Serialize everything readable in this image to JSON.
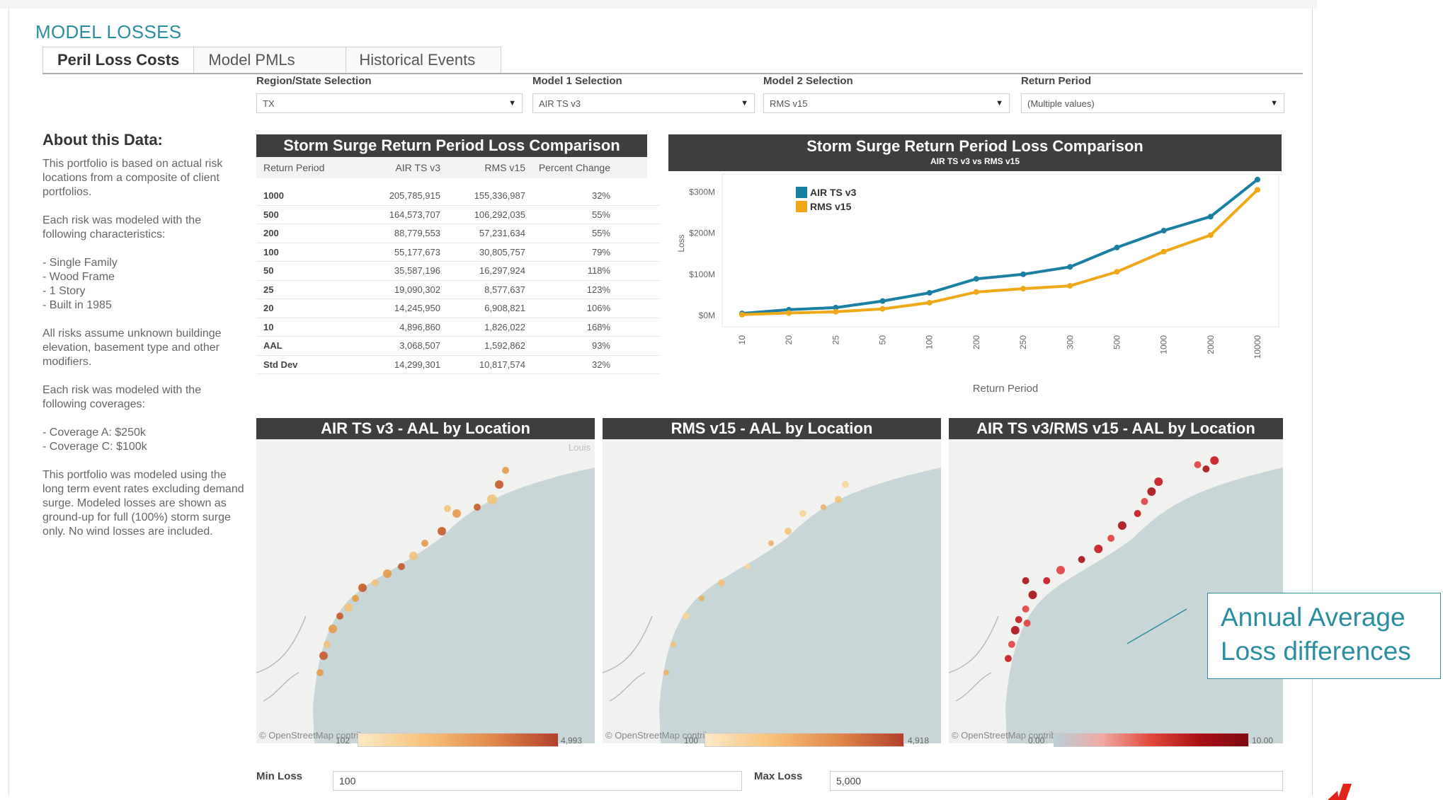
{
  "app": {
    "title": "MODEL LOSSES"
  },
  "tabs": [
    {
      "label": "Peril Loss Costs"
    },
    {
      "label": "Model PMLs"
    },
    {
      "label": "Historical Events"
    }
  ],
  "filters": [
    {
      "label": "Region/State Selection",
      "value": "TX"
    },
    {
      "label": "Model 1 Selection",
      "value": "AIR TS v3"
    },
    {
      "label": "Model 2 Selection",
      "value": "RMS v15"
    },
    {
      "label": "Return Period",
      "value": "(Multiple values)"
    }
  ],
  "about": {
    "title": "About this Data:",
    "paragraphs": [
      "This portfolio is based on actual risk locations from a composite of client portfolios.",
      "Each risk was modeled with the following characteristics:",
      "- Single Family\n- Wood Frame\n- 1 Story\n- Built in 1985",
      "All risks assume unknown buildinge elevation, basement type and other modifiers.",
      "Each risk was modeled with the following coverages:",
      "- Coverage A:  $250k\n- Coverage C:  $100k",
      "This portfolio was modeled using the long term event rates excluding demand surge. Modeled losses are shown as ground-up for full (100%) storm surge only. No wind losses are included."
    ]
  },
  "table": {
    "title": "Storm Surge Return Period Loss Comparison",
    "columns": [
      "Return Period",
      "AIR TS v3",
      "RMS v15",
      "Percent Change"
    ],
    "rows": [
      [
        "1000",
        "205,785,915",
        "155,336,987",
        "32%"
      ],
      [
        "500",
        "164,573,707",
        "106,292,035",
        "55%"
      ],
      [
        "200",
        "88,779,553",
        "57,231,634",
        "55%"
      ],
      [
        "100",
        "55,177,673",
        "30,805,757",
        "79%"
      ],
      [
        "50",
        "35,587,196",
        "16,297,924",
        "118%"
      ],
      [
        "25",
        "19,090,302",
        "8,577,637",
        "123%"
      ],
      [
        "20",
        "14,245,950",
        "6,908,821",
        "106%"
      ],
      [
        "10",
        "4,896,860",
        "1,826,022",
        "168%"
      ],
      [
        "AAL",
        "3,068,507",
        "1,592,862",
        "93%"
      ],
      [
        "Std Dev",
        "14,299,301",
        "10,817,574",
        "32%"
      ]
    ]
  },
  "chart_data": {
    "type": "line",
    "title": "Storm Surge Return Period Loss Comparison",
    "subtitle": "AIR TS v3 vs RMS v15",
    "xlabel": "Return Period",
    "ylabel": "Loss",
    "categories": [
      "10",
      "20",
      "25",
      "50",
      "100",
      "200",
      "250",
      "300",
      "500",
      "1000",
      "2000",
      "10000"
    ],
    "yticks": [
      "$0M",
      "$100M",
      "$200M",
      "$300M"
    ],
    "ylim": [
      0,
      340
    ],
    "series": [
      {
        "name": "AIR TS v3",
        "color": "#1b7fa3",
        "values": [
          5,
          14,
          19,
          35,
          55,
          89,
          100,
          118,
          165,
          206,
          240,
          330
        ]
      },
      {
        "name": "RMS v15",
        "color": "#f0a818",
        "values": [
          2,
          6,
          9,
          16,
          31,
          57,
          65,
          72,
          106,
          155,
          195,
          305
        ]
      }
    ],
    "legend": "top-left",
    "grid": false
  },
  "maps": [
    {
      "title": "AIR TS v3 - AAL by Location",
      "attribution": "© OpenStreetMap contributors",
      "legend_min": "102",
      "legend_max": "4,993",
      "place_label": "Louis"
    },
    {
      "title": "RMS v15 - AAL by Location",
      "attribution": "© OpenStreetMap contributors",
      "legend_min": "100",
      "legend_max": "4,918"
    },
    {
      "title": "AIR TS v3/RMS v15 - AAL by Location",
      "attribution": "© OpenStreetMap contributors",
      "legend_min": "0.00",
      "legend_max": "10.00"
    }
  ],
  "loss_filters": {
    "min_label": "Min Loss",
    "min_value": "100",
    "max_label": "Max Loss",
    "max_value": "5,000"
  },
  "callout": {
    "line1": "Annual Average",
    "line2": "Loss differences"
  },
  "colors": {
    "accent": "#2a8ea0",
    "header": "#3c3e40",
    "air": "#1b7fa3",
    "rms": "#f0a818",
    "diff": "#b5121b"
  }
}
